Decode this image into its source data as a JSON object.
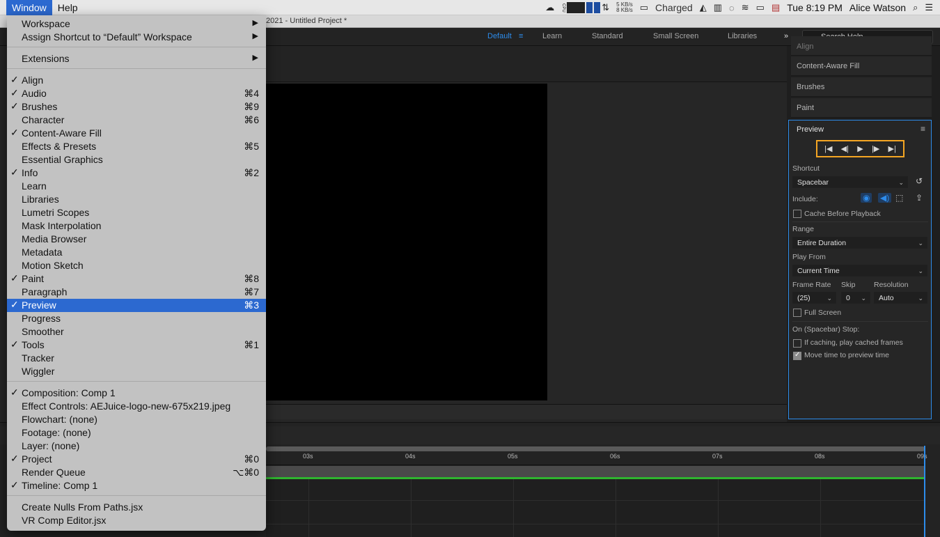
{
  "menubar": {
    "items": [
      "Window",
      "Help"
    ],
    "status": {
      "cpu_label": "CPU",
      "net_up": "5 KB/s",
      "net_down": "8 KB/s",
      "battery_text": "Charged",
      "datetime": "Tue 8:19 PM",
      "user": "Alice Watson"
    }
  },
  "titlebar": {
    "title": "2021 - Untitled Project *"
  },
  "workspace": {
    "tabs": [
      "Default",
      "Learn",
      "Standard",
      "Small Screen",
      "Libraries"
    ],
    "active_tab": "Default",
    "search_placeholder": "Search Help"
  },
  "right_panels": [
    "Align",
    "Content-Aware Fill",
    "Brushes",
    "Paint"
  ],
  "preview_panel": {
    "title": "Preview",
    "shortcut_label": "Shortcut",
    "shortcut_value": "Spacebar",
    "include_label": "Include:",
    "cache_label": "Cache Before Playback",
    "range_label": "Range",
    "range_value": "Entire Duration",
    "play_from_label": "Play From",
    "play_from_value": "Current Time",
    "frame_rate_label": "Frame Rate",
    "frame_rate_value": "(25)",
    "skip_label": "Skip",
    "skip_value": "0",
    "resolution_label": "Resolution",
    "resolution_value": "Auto",
    "full_screen_label": "Full Screen",
    "stop_label": "On (Spacebar) Stop:",
    "if_caching_label": "If caching, play cached frames",
    "move_time_label": "Move time to preview time",
    "move_time_checked": true,
    "accent_color": "#2d8ceb",
    "highlight_color": "#f5a623"
  },
  "timeline": {
    "ticks": [
      "03s",
      "04s",
      "05s",
      "06s",
      "07s",
      "08s",
      "09s"
    ]
  },
  "window_menu": {
    "sections": [
      [
        {
          "label": "Workspace",
          "submenu": true
        },
        {
          "label": "Assign Shortcut to “Default” Workspace",
          "submenu": true
        }
      ],
      [
        {
          "label": "Extensions",
          "submenu": true
        }
      ],
      [
        {
          "label": "Align",
          "checked": true
        },
        {
          "label": "Audio",
          "checked": true,
          "shortcut": "⌘4"
        },
        {
          "label": "Brushes",
          "checked": true,
          "shortcut": "⌘9"
        },
        {
          "label": "Character",
          "shortcut": "⌘6"
        },
        {
          "label": "Content-Aware Fill",
          "checked": true
        },
        {
          "label": "Effects & Presets",
          "shortcut": "⌘5"
        },
        {
          "label": "Essential Graphics"
        },
        {
          "label": "Info",
          "checked": true,
          "shortcut": "⌘2"
        },
        {
          "label": "Learn"
        },
        {
          "label": "Libraries"
        },
        {
          "label": "Lumetri Scopes"
        },
        {
          "label": "Mask Interpolation"
        },
        {
          "label": "Media Browser"
        },
        {
          "label": "Metadata"
        },
        {
          "label": "Motion Sketch"
        },
        {
          "label": "Paint",
          "checked": true,
          "shortcut": "⌘8"
        },
        {
          "label": "Paragraph",
          "shortcut": "⌘7"
        },
        {
          "label": "Preview",
          "checked": true,
          "shortcut": "⌘3",
          "highlighted": true
        },
        {
          "label": "Progress"
        },
        {
          "label": "Smoother"
        },
        {
          "label": "Tools",
          "checked": true,
          "shortcut": "⌘1"
        },
        {
          "label": "Tracker"
        },
        {
          "label": "Wiggler"
        }
      ],
      [
        {
          "label": "Composition: Comp 1",
          "checked": true
        },
        {
          "label": "Effect Controls: AEJuice-logo-new-675x219.jpeg"
        },
        {
          "label": "Flowchart: (none)"
        },
        {
          "label": "Footage: (none)"
        },
        {
          "label": "Layer: (none)"
        },
        {
          "label": "Project",
          "checked": true,
          "shortcut": "⌘0"
        },
        {
          "label": "Render Queue",
          "shortcut": "⌥⌘0"
        },
        {
          "label": "Timeline: Comp 1",
          "checked": true
        }
      ],
      [
        {
          "label": "Create Nulls From Paths.jsx"
        },
        {
          "label": "VR Comp Editor.jsx"
        }
      ]
    ]
  }
}
